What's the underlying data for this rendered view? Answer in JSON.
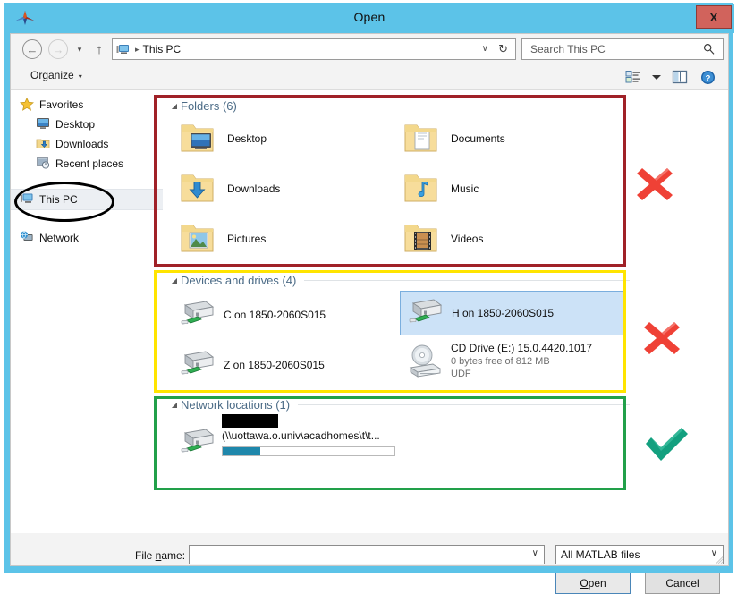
{
  "window": {
    "title": "Open",
    "app_icon": "matlab-membrane-icon",
    "close_label": "X",
    "close_color": "#d1635c",
    "titlebar_color": "#5cc3e8"
  },
  "nav": {
    "back_label": "←",
    "forward_label": "→",
    "recent_dropdown_label": "▾",
    "up_label": "↑",
    "address": {
      "icon": "this-pc-icon",
      "separator": "▸",
      "text": "This PC",
      "caret": "∨",
      "refresh": "↻"
    },
    "search": {
      "value": "",
      "placeholder": "Search This PC",
      "icon": "search-icon"
    }
  },
  "command_bar": {
    "organize_label": "Organize",
    "organize_caret": "▾",
    "icons": [
      "change-view-icon",
      "view-dropdown-caret",
      "preview-pane-icon",
      "help-icon"
    ]
  },
  "sidebar": {
    "items": [
      {
        "label": "Favorites",
        "icon": "star-icon",
        "indent": false,
        "selected": false
      },
      {
        "label": "Desktop",
        "icon": "desktop-icon",
        "indent": true,
        "selected": false
      },
      {
        "label": "Downloads",
        "icon": "downloads-folder-icon",
        "indent": true,
        "selected": false
      },
      {
        "label": "Recent places",
        "icon": "recent-places-icon",
        "indent": true,
        "selected": false
      },
      {
        "label": "This PC",
        "icon": "this-pc-icon",
        "indent": false,
        "selected": true
      },
      {
        "label": "Network",
        "icon": "network-globe-icon",
        "indent": false,
        "selected": false
      }
    ]
  },
  "content": {
    "groups": [
      {
        "id": "folders",
        "title": "Folders (6)",
        "collapse_icon": "◢",
        "items": [
          {
            "label": "Desktop",
            "icon": "folder-desktop-icon"
          },
          {
            "label": "Documents",
            "icon": "folder-documents-icon"
          },
          {
            "label": "Downloads",
            "icon": "folder-downloads-icon"
          },
          {
            "label": "Music",
            "icon": "folder-music-icon"
          },
          {
            "label": "Pictures",
            "icon": "folder-pictures-icon"
          },
          {
            "label": "Videos",
            "icon": "folder-videos-icon"
          }
        ]
      },
      {
        "id": "devices",
        "title": "Devices and drives (4)",
        "collapse_icon": "◢",
        "items": [
          {
            "label": "C on 1850-2060S015",
            "icon": "network-drive-icon",
            "selected": false
          },
          {
            "label": "H on 1850-2060S015",
            "icon": "network-drive-icon",
            "selected": true
          },
          {
            "label": "Z on 1850-2060S015",
            "icon": "network-drive-icon",
            "selected": false
          },
          {
            "label": "CD Drive (E:) 15.0.4420.1017",
            "icon": "cd-drive-icon",
            "selected": false,
            "sub1": "0 bytes free of 812 MB",
            "sub2": "UDF"
          }
        ]
      },
      {
        "id": "network-locations",
        "title": "Network locations (1)",
        "collapse_icon": "◢",
        "items": [
          {
            "label": "",
            "label_redacted": true,
            "icon": "network-drive-icon",
            "path": "(\\\\uottawa.o.univ\\acadhomes\\t\\t...",
            "usage_percent": 22,
            "usage_color": "#1f87ab"
          }
        ]
      }
    ]
  },
  "footer": {
    "file_name_label_pre": "File ",
    "file_name_label_key": "n",
    "file_name_label_post": "ame:",
    "file_name_value": "",
    "file_name_placeholder": "",
    "file_type_value": "All MATLAB files",
    "combo_caret": "∨",
    "open_pre": "",
    "open_key": "O",
    "open_post": "pen",
    "cancel_label": "Cancel"
  },
  "annotations": {
    "folders_box_color": "#a02128",
    "devices_box_color": "#ffe400",
    "network_box_color": "#22a04a",
    "ellipse_color": "#000000",
    "cross_color": "#ef4136",
    "check_color": "#13a07f",
    "marks": [
      {
        "type": "cross",
        "target": "folders"
      },
      {
        "type": "cross",
        "target": "devices"
      },
      {
        "type": "check",
        "target": "network-locations"
      }
    ]
  }
}
